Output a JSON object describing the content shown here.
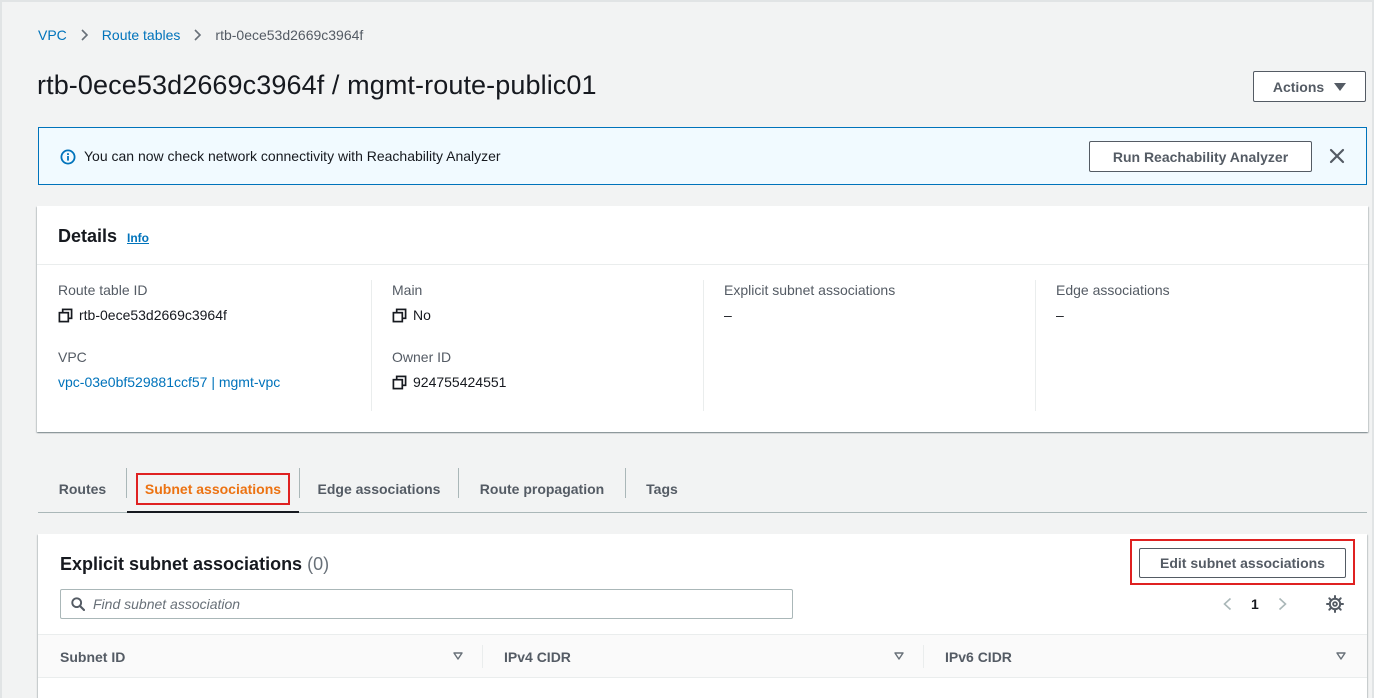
{
  "breadcrumb": {
    "items": [
      "VPC",
      "Route tables"
    ],
    "current": "rtb-0ece53d2669c3964f"
  },
  "page": {
    "title": "rtb-0ece53d2669c3964f / mgmt-route-public01",
    "actions_label": "Actions"
  },
  "banner": {
    "message": "You can now check network connectivity with Reachability Analyzer",
    "button_label": "Run Reachability Analyzer"
  },
  "details": {
    "title": "Details",
    "info_label": "Info",
    "route_table_id_label": "Route table ID",
    "route_table_id_value": "rtb-0ece53d2669c3964f",
    "vpc_label": "VPC",
    "vpc_value": "vpc-03e0bf529881ccf57 | mgmt-vpc",
    "main_label": "Main",
    "main_value": "No",
    "owner_id_label": "Owner ID",
    "owner_id_value": "924755424551",
    "explicit_label": "Explicit subnet associations",
    "explicit_value": "–",
    "edge_label": "Edge associations",
    "edge_value": "–"
  },
  "tabs": [
    {
      "label": "Routes"
    },
    {
      "label": "Subnet associations"
    },
    {
      "label": "Edge associations"
    },
    {
      "label": "Route propagation"
    },
    {
      "label": "Tags"
    }
  ],
  "table": {
    "title": "Explicit subnet associations",
    "count": "(0)",
    "edit_label": "Edit subnet associations",
    "search_placeholder": "Find subnet association",
    "page_number": "1",
    "columns": [
      "Subnet ID",
      "IPv4 CIDR",
      "IPv6 CIDR"
    ]
  },
  "colors": {
    "link": "#0073bb",
    "active_tab": "#ec7211",
    "highlight": "#df2121",
    "banner_bg": "#f1faff"
  }
}
